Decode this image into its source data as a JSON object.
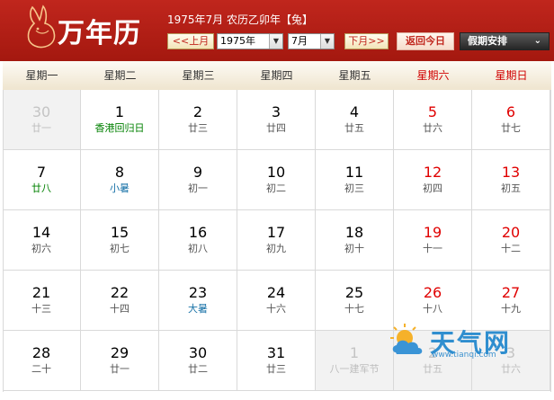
{
  "header": {
    "app_title": "万年历",
    "lunar_info": "1975年7月  农历乙卯年【兔】",
    "prev_month": "<<上月",
    "year_value": "1975年",
    "month_value": "7月",
    "next_month": "下月>>",
    "today_button": "返回今日",
    "holiday_button": "假期安排"
  },
  "weekdays": [
    "星期一",
    "星期二",
    "星期三",
    "星期四",
    "星期五",
    "星期六",
    "星期日"
  ],
  "weeks": [
    [
      {
        "day": "30",
        "sub": "廿一",
        "other": true,
        "weekend": false,
        "kind": ""
      },
      {
        "day": "1",
        "sub": "香港回归日",
        "other": false,
        "weekend": false,
        "kind": "festival"
      },
      {
        "day": "2",
        "sub": "廿三",
        "other": false,
        "weekend": false,
        "kind": ""
      },
      {
        "day": "3",
        "sub": "廿四",
        "other": false,
        "weekend": false,
        "kind": ""
      },
      {
        "day": "4",
        "sub": "廿五",
        "other": false,
        "weekend": false,
        "kind": ""
      },
      {
        "day": "5",
        "sub": "廿六",
        "other": false,
        "weekend": true,
        "kind": ""
      },
      {
        "day": "6",
        "sub": "廿七",
        "other": false,
        "weekend": true,
        "kind": ""
      }
    ],
    [
      {
        "day": "7",
        "sub": "廿八",
        "other": false,
        "weekend": false,
        "kind": "festival"
      },
      {
        "day": "8",
        "sub": "小暑",
        "other": false,
        "weekend": false,
        "kind": "term"
      },
      {
        "day": "9",
        "sub": "初一",
        "other": false,
        "weekend": false,
        "kind": ""
      },
      {
        "day": "10",
        "sub": "初二",
        "other": false,
        "weekend": false,
        "kind": ""
      },
      {
        "day": "11",
        "sub": "初三",
        "other": false,
        "weekend": false,
        "kind": ""
      },
      {
        "day": "12",
        "sub": "初四",
        "other": false,
        "weekend": true,
        "kind": ""
      },
      {
        "day": "13",
        "sub": "初五",
        "other": false,
        "weekend": true,
        "kind": ""
      }
    ],
    [
      {
        "day": "14",
        "sub": "初六",
        "other": false,
        "weekend": false,
        "kind": ""
      },
      {
        "day": "15",
        "sub": "初七",
        "other": false,
        "weekend": false,
        "kind": ""
      },
      {
        "day": "16",
        "sub": "初八",
        "other": false,
        "weekend": false,
        "kind": ""
      },
      {
        "day": "17",
        "sub": "初九",
        "other": false,
        "weekend": false,
        "kind": ""
      },
      {
        "day": "18",
        "sub": "初十",
        "other": false,
        "weekend": false,
        "kind": ""
      },
      {
        "day": "19",
        "sub": "十一",
        "other": false,
        "weekend": true,
        "kind": ""
      },
      {
        "day": "20",
        "sub": "十二",
        "other": false,
        "weekend": true,
        "kind": ""
      }
    ],
    [
      {
        "day": "21",
        "sub": "十三",
        "other": false,
        "weekend": false,
        "kind": ""
      },
      {
        "day": "22",
        "sub": "十四",
        "other": false,
        "weekend": false,
        "kind": ""
      },
      {
        "day": "23",
        "sub": "大暑",
        "other": false,
        "weekend": false,
        "kind": "term"
      },
      {
        "day": "24",
        "sub": "十六",
        "other": false,
        "weekend": false,
        "kind": ""
      },
      {
        "day": "25",
        "sub": "十七",
        "other": false,
        "weekend": false,
        "kind": ""
      },
      {
        "day": "26",
        "sub": "十八",
        "other": false,
        "weekend": true,
        "kind": ""
      },
      {
        "day": "27",
        "sub": "十九",
        "other": false,
        "weekend": true,
        "kind": ""
      }
    ],
    [
      {
        "day": "28",
        "sub": "二十",
        "other": false,
        "weekend": false,
        "kind": ""
      },
      {
        "day": "29",
        "sub": "廿一",
        "other": false,
        "weekend": false,
        "kind": ""
      },
      {
        "day": "30",
        "sub": "廿二",
        "other": false,
        "weekend": false,
        "kind": ""
      },
      {
        "day": "31",
        "sub": "廿三",
        "other": false,
        "weekend": false,
        "kind": ""
      },
      {
        "day": "1",
        "sub": "八一建军节",
        "other": true,
        "weekend": false,
        "kind": "festival"
      },
      {
        "day": "2",
        "sub": "廿五",
        "other": true,
        "weekend": true,
        "kind": ""
      },
      {
        "day": "3",
        "sub": "廿六",
        "other": true,
        "weekend": true,
        "kind": ""
      }
    ]
  ],
  "watermark": {
    "brand": "天气网",
    "url": "www.tianqi.com"
  },
  "colors": {
    "header_red": "#b81f16",
    "weekend_red": "#e00000",
    "festival_green": "#008000",
    "term_blue": "#1a73a8"
  }
}
